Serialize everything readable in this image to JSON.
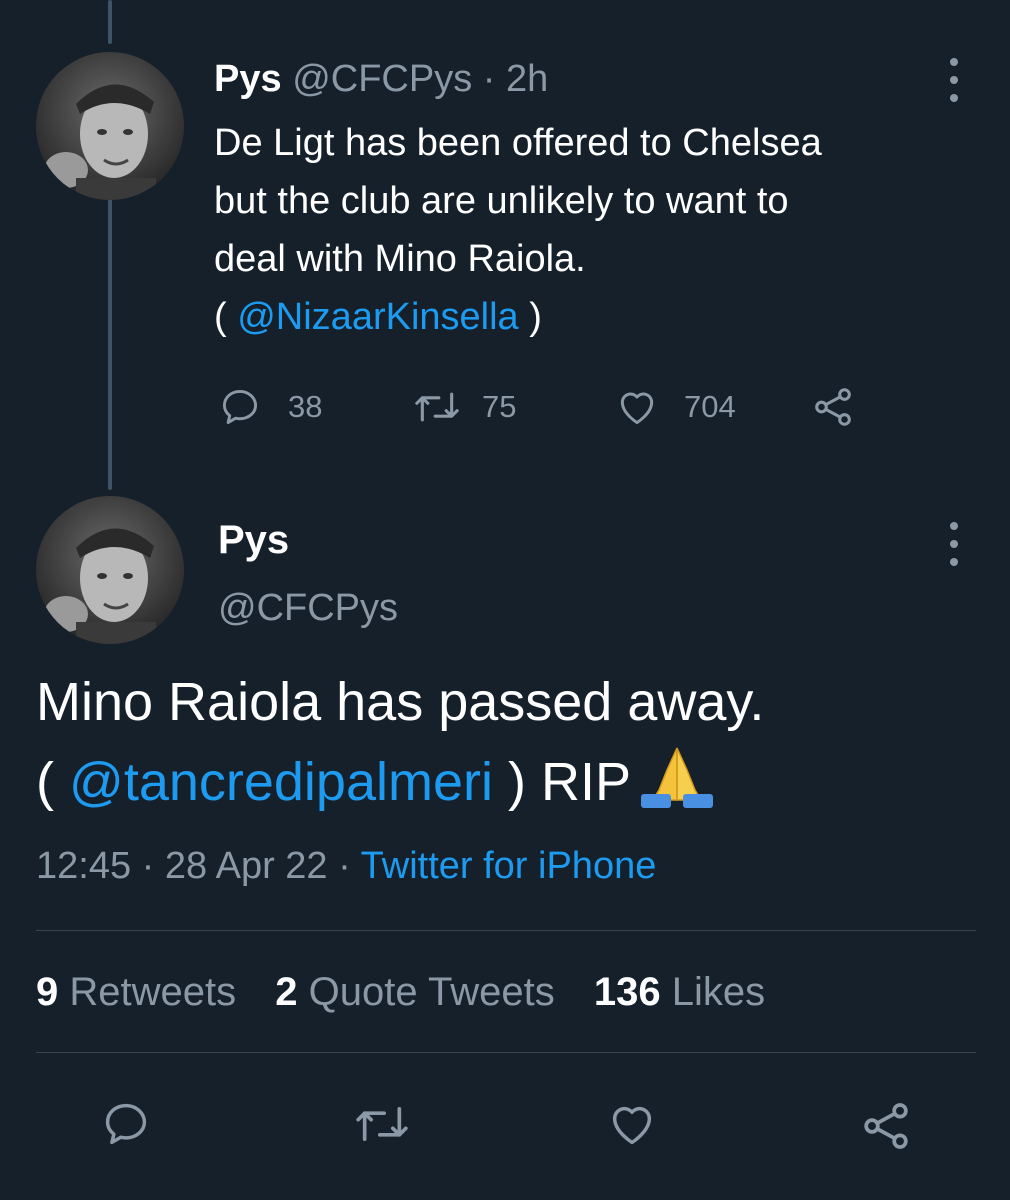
{
  "tweet1": {
    "name": "Pys",
    "handle": "@CFCPys",
    "separator": "·",
    "time": "2h",
    "text_lines": [
      "De Ligt has been offered to Chelsea",
      "but the club are unlikely to want to",
      "deal with Mino Raiola."
    ],
    "mention_open": "( ",
    "mention": "@NizaarKinsella",
    "mention_close": " )",
    "replies": "38",
    "retweets": "75",
    "likes": "704"
  },
  "tweet2": {
    "name": "Pys",
    "handle": "@CFCPys",
    "text_line1": "Mino Raiola has passed away.",
    "mention_open": "( ",
    "mention": "@tancredipalmeri",
    "mention_close": " ) RIP",
    "emoji": "folded-hands-emoji",
    "time": "12:45",
    "date": "28 Apr 22",
    "separator": "·",
    "source": "Twitter for iPhone",
    "stats": {
      "retweets_count": "9",
      "retweets_label": "Retweets",
      "quotes_count": "2",
      "quotes_label": "Quote Tweets",
      "likes_count": "136",
      "likes_label": "Likes"
    }
  },
  "colors": {
    "background": "#15202b",
    "text": "#ffffff",
    "muted": "#8b98a5",
    "link": "#1d9bf0",
    "divider": "#38444d"
  }
}
